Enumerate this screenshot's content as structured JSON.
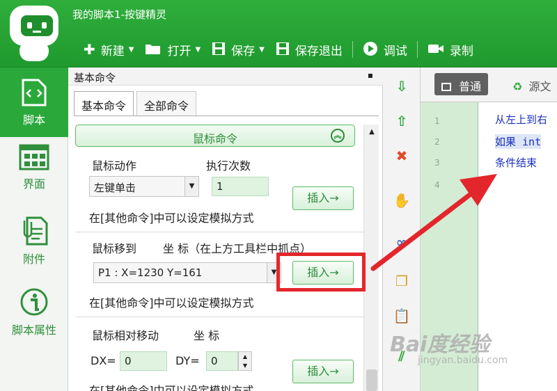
{
  "window": {
    "title": "我的脚本1-按键精灵"
  },
  "toolbar": {
    "items": [
      {
        "label": "新建"
      },
      {
        "label": "打开"
      },
      {
        "label": "保存"
      },
      {
        "label": "保存退出"
      },
      {
        "label": "调试"
      },
      {
        "label": "录制"
      }
    ]
  },
  "leftnav": {
    "items": [
      {
        "label": "脚本"
      },
      {
        "label": "界面"
      },
      {
        "label": "附件"
      },
      {
        "label": "脚本属性"
      }
    ]
  },
  "panel": {
    "title": "基本命令",
    "tabs": [
      {
        "label": "基本命令"
      },
      {
        "label": "全部命令"
      }
    ],
    "section_title": "鼠标命令",
    "mouse_action": {
      "label": "鼠标动作",
      "count_label": "执行次数",
      "action_value": "左键单击",
      "count_value": "1",
      "insert_label": "插入→",
      "hint": "在[其他命令]中可以设定模拟方式"
    },
    "mouse_move": {
      "label": "鼠标移到",
      "coord_label": "坐 标（在上方工具栏中抓点）",
      "point_value": "P1 : X=1230 Y=161",
      "insert_label": "插入→",
      "hint": "在[其他命令]中可以设定模拟方式"
    },
    "mouse_relative": {
      "label": "鼠标相对移动",
      "coord_label": "坐 标",
      "dx_label": "DX=",
      "dx_value": "0",
      "dy_label": "DY=",
      "dy_value": "0",
      "insert_label": "插入→",
      "hint": "在[其他命令]中可以设定模拟方式"
    }
  },
  "editor": {
    "tabs": [
      {
        "label": "普通"
      },
      {
        "label": "源文"
      }
    ],
    "line_numbers": [
      "1",
      "2",
      "3",
      "4"
    ],
    "lines": [
      "从左上到右",
      "如果 int",
      "条件结束"
    ]
  },
  "watermark": {
    "text": "Bai度经验",
    "sub": "jingyan.baidu.com"
  },
  "colors": {
    "accent": "#2aa83a",
    "annotation": "#e3262c"
  }
}
